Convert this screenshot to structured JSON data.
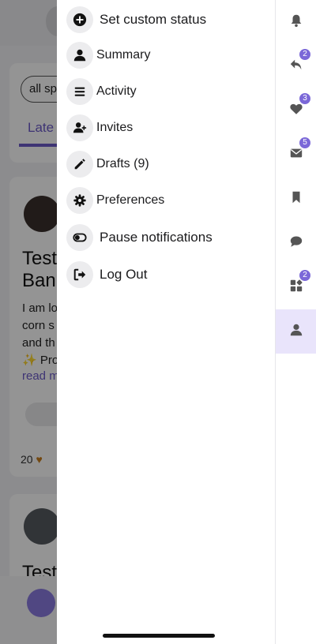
{
  "background": {
    "filter_pill": "all sp",
    "tab_label": "Late",
    "post1_title_line1": "Test",
    "post1_title_line2": "Ban",
    "post1_text_lines": [
      "I am lo",
      "corn s",
      "and th",
      "✨ Pro"
    ],
    "post1_link": "read m",
    "post1_likes": "20",
    "post2_title": "Test"
  },
  "menu": {
    "items": [
      {
        "label": "Set custom status",
        "icon": "plus-circle-icon"
      },
      {
        "label": "Summary",
        "icon": "user-icon"
      },
      {
        "label": "Activity",
        "icon": "list-icon"
      },
      {
        "label": "Invites",
        "icon": "user-plus-icon"
      },
      {
        "label": "Drafts (9)",
        "icon": "pencil-icon"
      },
      {
        "label": "Preferences",
        "icon": "gear-icon"
      },
      {
        "label": "Pause notifications",
        "icon": "toggle-icon"
      },
      {
        "label": "Log Out",
        "icon": "logout-icon"
      }
    ]
  },
  "rail": {
    "items": [
      {
        "icon": "bell-icon",
        "badge": ""
      },
      {
        "icon": "reply-icon",
        "badge": "2"
      },
      {
        "icon": "heart-icon",
        "badge": "3"
      },
      {
        "icon": "envelope-icon",
        "badge": "5"
      },
      {
        "icon": "bookmark-icon",
        "badge": ""
      },
      {
        "icon": "chat-bubble-icon",
        "badge": ""
      },
      {
        "icon": "widgets-icon",
        "badge": "2"
      },
      {
        "icon": "user-icon",
        "badge": ""
      }
    ],
    "active_index": 7
  },
  "colors": {
    "accent": "#7b68d8",
    "active_tab_bg": "#e9e4fb",
    "icon_circle_bg": "#ececee"
  }
}
